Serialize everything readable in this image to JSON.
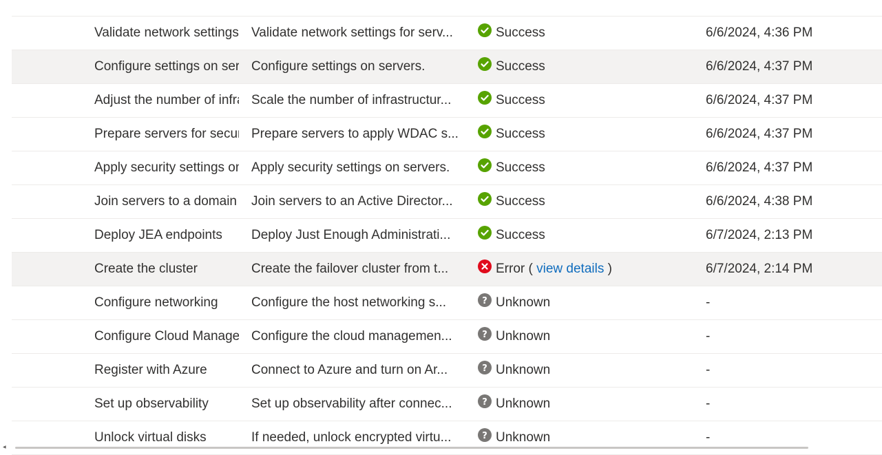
{
  "rows": [
    {
      "name": "Validate network settings",
      "description": "Validate network settings for servers.",
      "description_display": "Validate network settings for serv...",
      "status": "Success",
      "status_type": "success",
      "time": "6/6/2024, 4:36 PM",
      "alt": false
    },
    {
      "name": "Configure settings on servers",
      "description": "Configure settings on servers.",
      "description_display": "Configure settings on servers.",
      "status": "Success",
      "status_type": "success",
      "time": "6/6/2024, 4:37 PM",
      "alt": true
    },
    {
      "name": "Adjust the number of infrastructure",
      "description": "Scale the number of infrastructure",
      "description_display": "Scale the number of infrastructur...",
      "status": "Success",
      "status_type": "success",
      "time": "6/6/2024, 4:37 PM",
      "alt": false
    },
    {
      "name": "Prepare servers for security",
      "description": "Prepare servers to apply WDAC s",
      "description_display": "Prepare servers to apply WDAC s...",
      "status": "Success",
      "status_type": "success",
      "time": "6/6/2024, 4:37 PM",
      "alt": false
    },
    {
      "name": "Apply security settings on servers",
      "description": "Apply security settings on servers.",
      "description_display": "Apply security settings on servers.",
      "status": "Success",
      "status_type": "success",
      "time": "6/6/2024, 4:37 PM",
      "alt": false
    },
    {
      "name": "Join servers to a domain",
      "description": "Join servers to an Active Director",
      "description_display": "Join servers to an Active Director...",
      "status": "Success",
      "status_type": "success",
      "time": "6/6/2024, 4:38 PM",
      "alt": false
    },
    {
      "name": "Deploy JEA endpoints",
      "description": "Deploy Just Enough Administrati",
      "description_display": "Deploy Just Enough Administrati...",
      "status": "Success",
      "status_type": "success",
      "time": "6/7/2024, 2:13 PM",
      "alt": false
    },
    {
      "name": "Create the cluster",
      "description": "Create the failover cluster from t",
      "description_display": "Create the failover cluster from t...",
      "status": "Error",
      "status_type": "error",
      "time": "6/7/2024, 2:14 PM",
      "alt": true,
      "details_link": "view details"
    },
    {
      "name": "Configure networking",
      "description": "Configure the host networking s",
      "description_display": "Configure the host networking s...",
      "status": "Unknown",
      "status_type": "unknown",
      "time": "-",
      "alt": false
    },
    {
      "name": "Configure Cloud Management",
      "description": "Configure the cloud managemen",
      "description_display": "Configure the cloud managemen...",
      "status": "Unknown",
      "status_type": "unknown",
      "time": "-",
      "alt": false
    },
    {
      "name": "Register with Azure",
      "description": "Connect to Azure and turn on Ar",
      "description_display": "Connect to Azure and turn on Ar...",
      "status": "Unknown",
      "status_type": "unknown",
      "time": "-",
      "alt": false
    },
    {
      "name": "Set up observability",
      "description": "Set up observability after connec",
      "description_display": "Set up observability after connec...",
      "status": "Unknown",
      "status_type": "unknown",
      "time": "-",
      "alt": false
    },
    {
      "name": "Unlock virtual disks",
      "description": "If needed, unlock encrypted virtu",
      "description_display": "If needed, unlock encrypted virtu...",
      "status": "Unknown",
      "status_type": "unknown",
      "time": "-",
      "alt": false
    }
  ],
  "colors": {
    "success": "#57a300",
    "error": "#e00b1c",
    "unknown": "#797775",
    "link": "#0f6cbd",
    "alt_row": "#f3f2f1"
  },
  "icons": {
    "success": "checkmark-circle-icon",
    "error": "error-circle-icon",
    "unknown": "question-circle-icon"
  }
}
